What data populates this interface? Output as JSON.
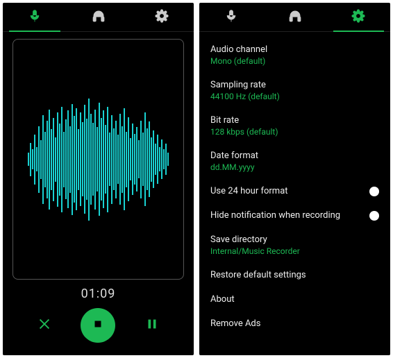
{
  "accent": "#1db954",
  "waveColor": "#19d2d2",
  "tabs": [
    "mic",
    "headphones",
    "settings"
  ],
  "left": {
    "activeTab": "mic",
    "timer": "01:09",
    "controls": {
      "cancel": "cancel",
      "stop": "stop",
      "pause": "pause"
    },
    "waveform_bars": [
      12,
      30,
      18,
      45,
      22,
      60,
      35,
      80,
      50,
      70,
      90,
      55,
      75,
      40,
      85,
      65,
      95,
      50,
      72,
      88,
      60,
      100,
      78,
      92,
      55,
      84,
      67,
      98,
      73,
      110,
      82,
      66,
      90,
      58,
      102,
      74,
      88,
      62,
      95,
      48,
      80,
      56,
      70,
      44,
      82,
      60,
      92,
      50,
      76,
      38,
      64,
      46,
      58,
      34,
      70,
      48,
      84,
      56,
      68,
      40,
      52,
      28,
      44,
      22,
      36,
      18,
      28,
      12
    ]
  },
  "right": {
    "activeTab": "settings",
    "settings": {
      "audio_channel": {
        "label": "Audio channel",
        "value": "Mono (default)"
      },
      "sampling_rate": {
        "label": "Sampling rate",
        "value": "44100 Hz (default)"
      },
      "bit_rate": {
        "label": "Bit rate",
        "value": "128 kbps (default)"
      },
      "date_format": {
        "label": "Date format",
        "value": "dd.MM.yyyy"
      },
      "use_24h": {
        "label": "Use 24 hour format",
        "on": false
      },
      "hide_notification": {
        "label": "Hide notification when recording",
        "on": false
      },
      "save_directory": {
        "label": "Save directory",
        "value": "Internal/Music Recorder"
      },
      "restore_defaults": {
        "label": "Restore default settings"
      },
      "about": {
        "label": "About"
      },
      "remove_ads": {
        "label": "Remove Ads"
      }
    }
  }
}
